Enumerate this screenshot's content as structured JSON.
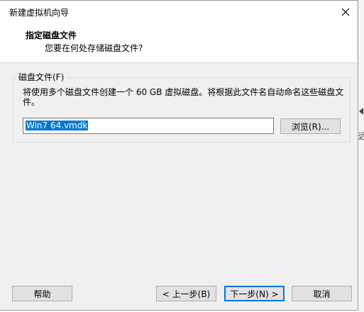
{
  "window": {
    "title": "新建虚拟机向导"
  },
  "header": {
    "title": "指定磁盘文件",
    "subtitle": "您要在何处存储磁盘文件?"
  },
  "disk_file_group": {
    "label": "磁盘文件(F)",
    "description": "将使用多个磁盘文件创建一个 60 GB 虚拟磁盘。将根据此文件名自动命名这些磁盘文件。",
    "filename_value": "Win7 64.vmdk",
    "browse_label": "浏览(R)..."
  },
  "footer": {
    "help_label": "帮助",
    "back_label": "< 上一步(B)",
    "next_label": "下一步(N) >",
    "cancel_label": "取消"
  },
  "background_app": {
    "partial_glyph": "远"
  },
  "colors": {
    "selection": "#0078d7",
    "dialog_bg": "#f0f0f0",
    "button_bg": "#e1e1e1"
  },
  "icons": {
    "close": "close-icon",
    "arrow": "chevron-left-icon"
  }
}
